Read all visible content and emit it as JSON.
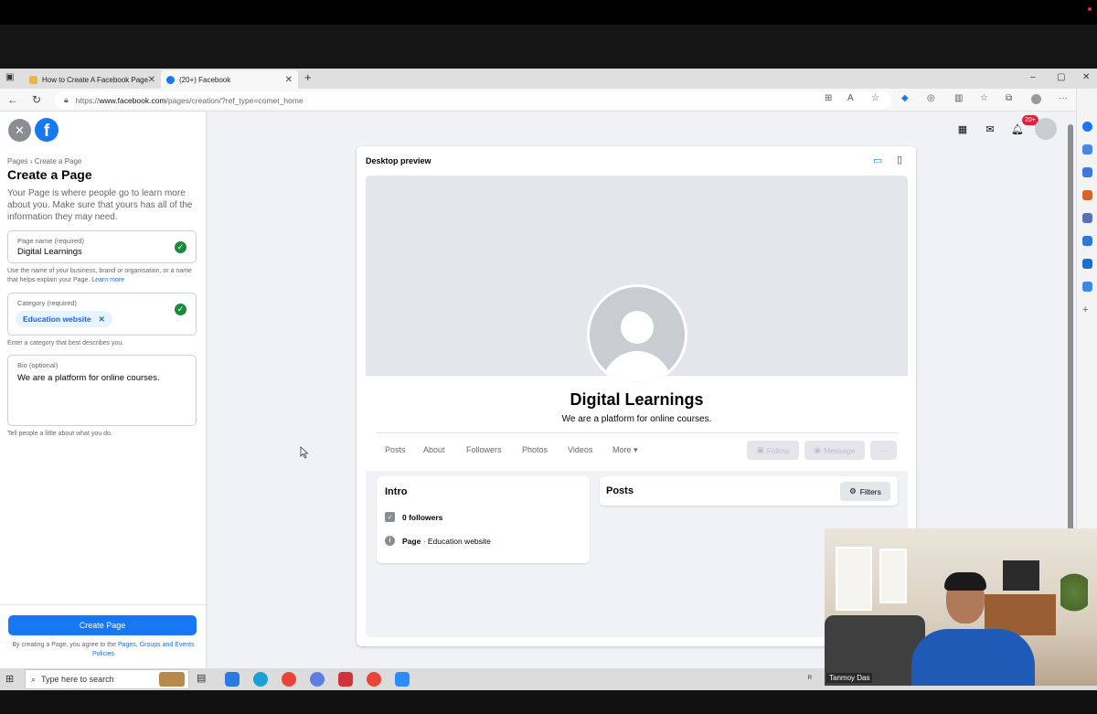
{
  "browser": {
    "tabs": [
      {
        "label": "How to Create A Facebook Page",
        "active": false
      },
      {
        "label": "(20+) Facebook",
        "active": true
      }
    ],
    "url_prefix": "https://",
    "url_domain": "www.facebook.com",
    "url_path": "/pages/creation/?ref_type=comet_home",
    "window_controls": {
      "min": "–",
      "max": "▢",
      "close": "✕"
    }
  },
  "left_panel": {
    "breadcrumb": "Pages › Create a Page",
    "title": "Create a Page",
    "description": "Your Page is where people go to learn more about you. Make sure that yours has all of the information they may need.",
    "page_name": {
      "label": "Page name (required)",
      "value": "Digital Learnings"
    },
    "page_name_help": "Use the name of your business, brand or organisation, or a name that helps explain your Page.",
    "learn_more": "Learn more",
    "category": {
      "label": "Category (required)",
      "chip": "Education website",
      "chip_remove": "✕"
    },
    "category_help": "Enter a category that best describes you.",
    "bio": {
      "label": "Bio (optional)",
      "value": "We are a platform for online courses."
    },
    "bio_help": "Tell people a little about what you do.",
    "create_button": "Create Page",
    "terms_prefix": "By creating a Page, you agree to the",
    "terms_link": "Pages, Groups and Events Policies"
  },
  "preview": {
    "label": "Desktop preview",
    "page_name": "Digital Learnings",
    "bio": "We are a platform for online courses.",
    "tabs": [
      "Posts",
      "About",
      "Followers",
      "Photos",
      "Videos",
      "More ▾"
    ],
    "follow": "Follow",
    "message": "Message",
    "more_dots": "···",
    "intro_title": "Intro",
    "followers": "0 followers",
    "page_type_bold": "Page",
    "page_type_rest": " · Education website",
    "posts_title": "Posts",
    "filters": "Filters"
  },
  "fb_header": {
    "notification_badge": "20+"
  },
  "taskbar": {
    "search_placeholder": "Type here to search"
  },
  "webcam": {
    "name": "Tanmoy Das"
  },
  "colors": {
    "fb_blue": "#1877f2",
    "success_green": "#1b8a3a",
    "badge_red": "#e41e3f"
  }
}
